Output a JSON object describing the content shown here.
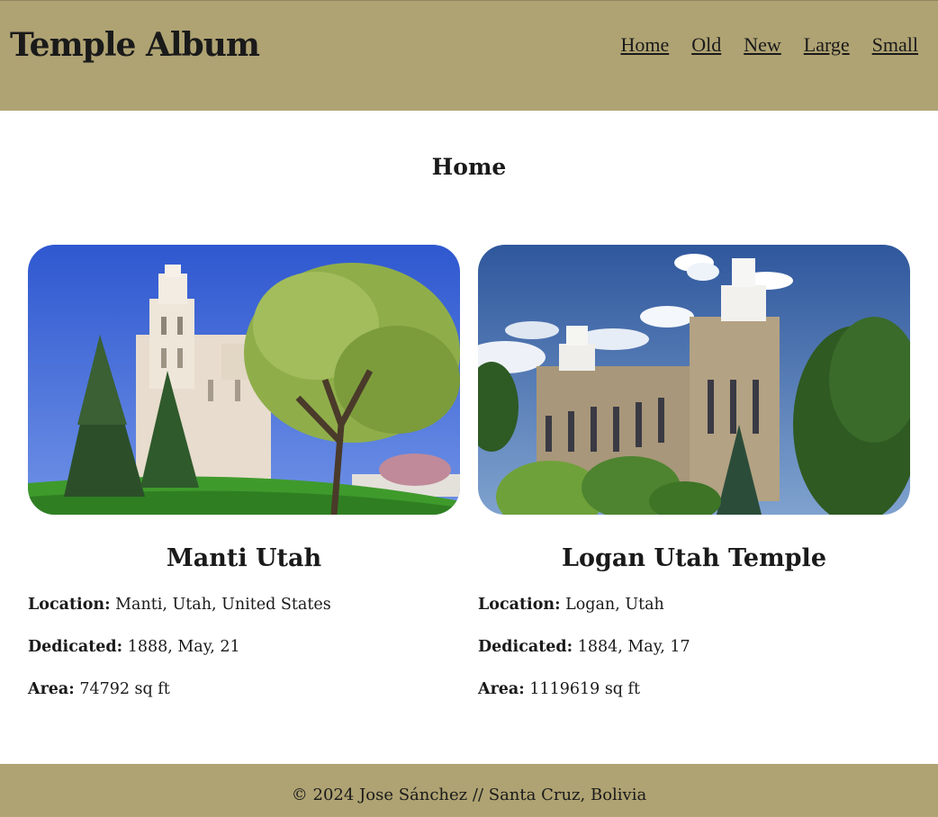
{
  "header": {
    "title": "Temple Album",
    "nav": [
      "Home",
      "Old",
      "New",
      "Large",
      "Small"
    ]
  },
  "main": {
    "heading": "Home",
    "temples": [
      {
        "name": "Manti Utah",
        "location_label": "Location:",
        "location": "Manti, Utah, United States",
        "dedicated_label": "Dedicated:",
        "dedicated": "1888, May, 21",
        "area_label": "Area:",
        "area": "74792 sq ft"
      },
      {
        "name": "Logan Utah Temple",
        "location_label": "Location:",
        "location": "Logan, Utah",
        "dedicated_label": "Dedicated:",
        "dedicated": "1884, May, 17",
        "area_label": "Area:",
        "area": "1119619 sq ft"
      }
    ]
  },
  "footer": {
    "text": "© 2024 Jose Sánchez // Santa Cruz, Bolivia"
  },
  "colors": {
    "bar": "#afa373",
    "text": "#1a1a1a"
  }
}
